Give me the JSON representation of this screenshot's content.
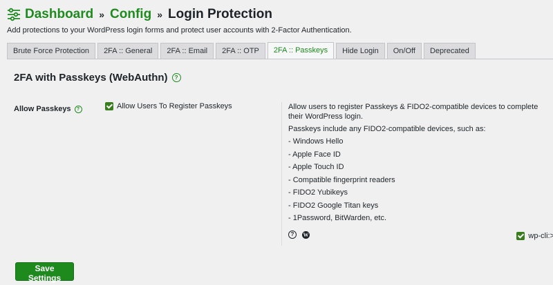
{
  "header": {
    "crumbs": [
      "Dashboard",
      "Config"
    ],
    "separator": "»",
    "current": "Login Protection",
    "subtitle": "Add protections to your WordPress login forms and protect user accounts with 2-Factor Authentication."
  },
  "tabs": [
    {
      "label": "Brute Force Protection",
      "active": false
    },
    {
      "label": "2FA :: General",
      "active": false
    },
    {
      "label": "2FA :: Email",
      "active": false
    },
    {
      "label": "2FA :: OTP",
      "active": false
    },
    {
      "label": "2FA :: Passkeys",
      "active": true
    },
    {
      "label": "Hide Login",
      "active": false
    },
    {
      "label": "On/Off",
      "active": false
    },
    {
      "label": "Deprecated",
      "active": false
    }
  ],
  "section": {
    "title": "2FA with Passkeys (WebAuthn)",
    "help_glyph": "?"
  },
  "setting": {
    "label": "Allow Passkeys",
    "checkbox_label": "Allow Users To Register Passkeys",
    "checked": true
  },
  "description": {
    "intro": "Allow users to register Passkeys & FIDO2-compatible devices to complete their WordPress login.",
    "lead": "Passkeys include any FIDO2-compatible devices, such as:",
    "items": [
      "- Windows Hello",
      "- Apple Face ID",
      "- Apple Touch ID",
      "- Compatible fingerprint readers",
      "- FIDO2 Yubikeys",
      "- FIDO2 Google Titan keys",
      "- 1Password, BitWarden, etc."
    ],
    "wp_glyph": "W",
    "wpcli_label": "wp-cli:>",
    "wpcli_checked": true
  },
  "footer": {
    "save_label": "Save Settings"
  },
  "colors": {
    "accent": "#1f8a1f",
    "checkbox": "#3a7d1e",
    "background": "#f0f0f1"
  }
}
